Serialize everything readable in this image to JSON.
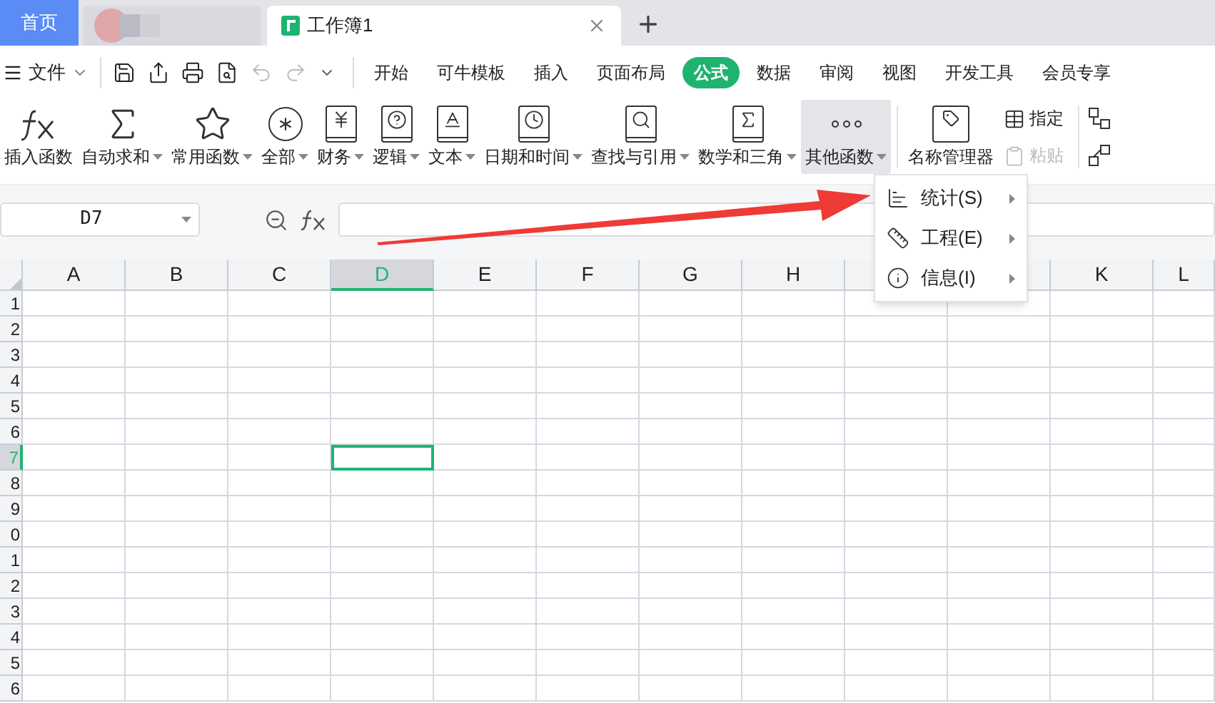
{
  "tabs": [
    {
      "kind": "home",
      "label": "首页",
      "selected": false
    },
    {
      "kind": "blurred",
      "selected": false
    },
    {
      "kind": "doc",
      "label": "工作簿1",
      "selected": true
    }
  ],
  "file_menu": {
    "label": "文件"
  },
  "menu_tabs": [
    {
      "label": "开始",
      "selected": false
    },
    {
      "label": "可牛模板",
      "selected": false
    },
    {
      "label": "插入",
      "selected": false
    },
    {
      "label": "页面布局",
      "selected": false
    },
    {
      "label": "公式",
      "selected": true
    },
    {
      "label": "数据",
      "selected": false
    },
    {
      "label": "审阅",
      "selected": false
    },
    {
      "label": "视图",
      "selected": false
    },
    {
      "label": "开发工具",
      "selected": false
    },
    {
      "label": "会员专享",
      "selected": false
    }
  ],
  "ribbon": [
    {
      "kind": "fx",
      "label": "插入函数",
      "dropdown": false,
      "hovered": false
    },
    {
      "kind": "sum",
      "label": "自动求和",
      "dropdown": true,
      "hovered": false
    },
    {
      "kind": "star",
      "label": "常用函数",
      "dropdown": true,
      "hovered": false
    },
    {
      "kind": "all",
      "label": "全部",
      "dropdown": true,
      "hovered": false
    },
    {
      "kind": "finance",
      "label": "财务",
      "dropdown": true,
      "hovered": false
    },
    {
      "kind": "logic",
      "label": "逻辑",
      "dropdown": true,
      "hovered": false
    },
    {
      "kind": "text",
      "label": "文本",
      "dropdown": true,
      "hovered": false
    },
    {
      "kind": "date",
      "label": "日期和时间",
      "dropdown": true,
      "hovered": false
    },
    {
      "kind": "lookup",
      "label": "查找与引用",
      "dropdown": true,
      "hovered": false
    },
    {
      "kind": "math",
      "label": "数学和三角",
      "dropdown": true,
      "hovered": false
    },
    {
      "kind": "more",
      "label": "其他函数",
      "dropdown": true,
      "hovered": true
    },
    {
      "kind": "names",
      "label": "名称管理器",
      "dropdown": false,
      "hovered": false
    }
  ],
  "ribbon_small": [
    {
      "label": "指定",
      "disabled": false
    },
    {
      "label": "粘贴",
      "disabled": true
    }
  ],
  "name_box": {
    "value": "D7"
  },
  "grid": {
    "columns": [
      {
        "label": "A",
        "selected": false
      },
      {
        "label": "B",
        "selected": false
      },
      {
        "label": "C",
        "selected": false
      },
      {
        "label": "D",
        "selected": true
      },
      {
        "label": "E",
        "selected": false
      },
      {
        "label": "F",
        "selected": false
      },
      {
        "label": "G",
        "selected": false
      },
      {
        "label": "H",
        "selected": false
      },
      {
        "selected": false
      },
      {
        "selected": false
      },
      {
        "label": "K",
        "selected": false
      },
      {
        "label": "L",
        "selected": false
      }
    ],
    "rows": [
      {
        "label": "1",
        "selected": false
      },
      {
        "label": "2",
        "selected": false
      },
      {
        "label": "3",
        "selected": false
      },
      {
        "label": "4",
        "selected": false
      },
      {
        "label": "5",
        "selected": false
      },
      {
        "label": "6",
        "selected": false
      },
      {
        "label": "7",
        "selected": true
      },
      {
        "label": "8",
        "selected": false
      },
      {
        "label": "9",
        "selected": false
      },
      {
        "label": "0",
        "selected": false
      },
      {
        "label": "1",
        "selected": false
      },
      {
        "label": "2",
        "selected": false
      },
      {
        "label": "3",
        "selected": false
      },
      {
        "label": "4",
        "selected": false
      },
      {
        "label": "5",
        "selected": false
      },
      {
        "label": "6",
        "selected": false
      }
    ]
  },
  "dropdown_menu": {
    "items": [
      {
        "kind": "stats",
        "label": "统计(S)"
      },
      {
        "kind": "engineering",
        "label": "工程(E)"
      },
      {
        "kind": "info",
        "label": "信息(I)"
      }
    ]
  }
}
